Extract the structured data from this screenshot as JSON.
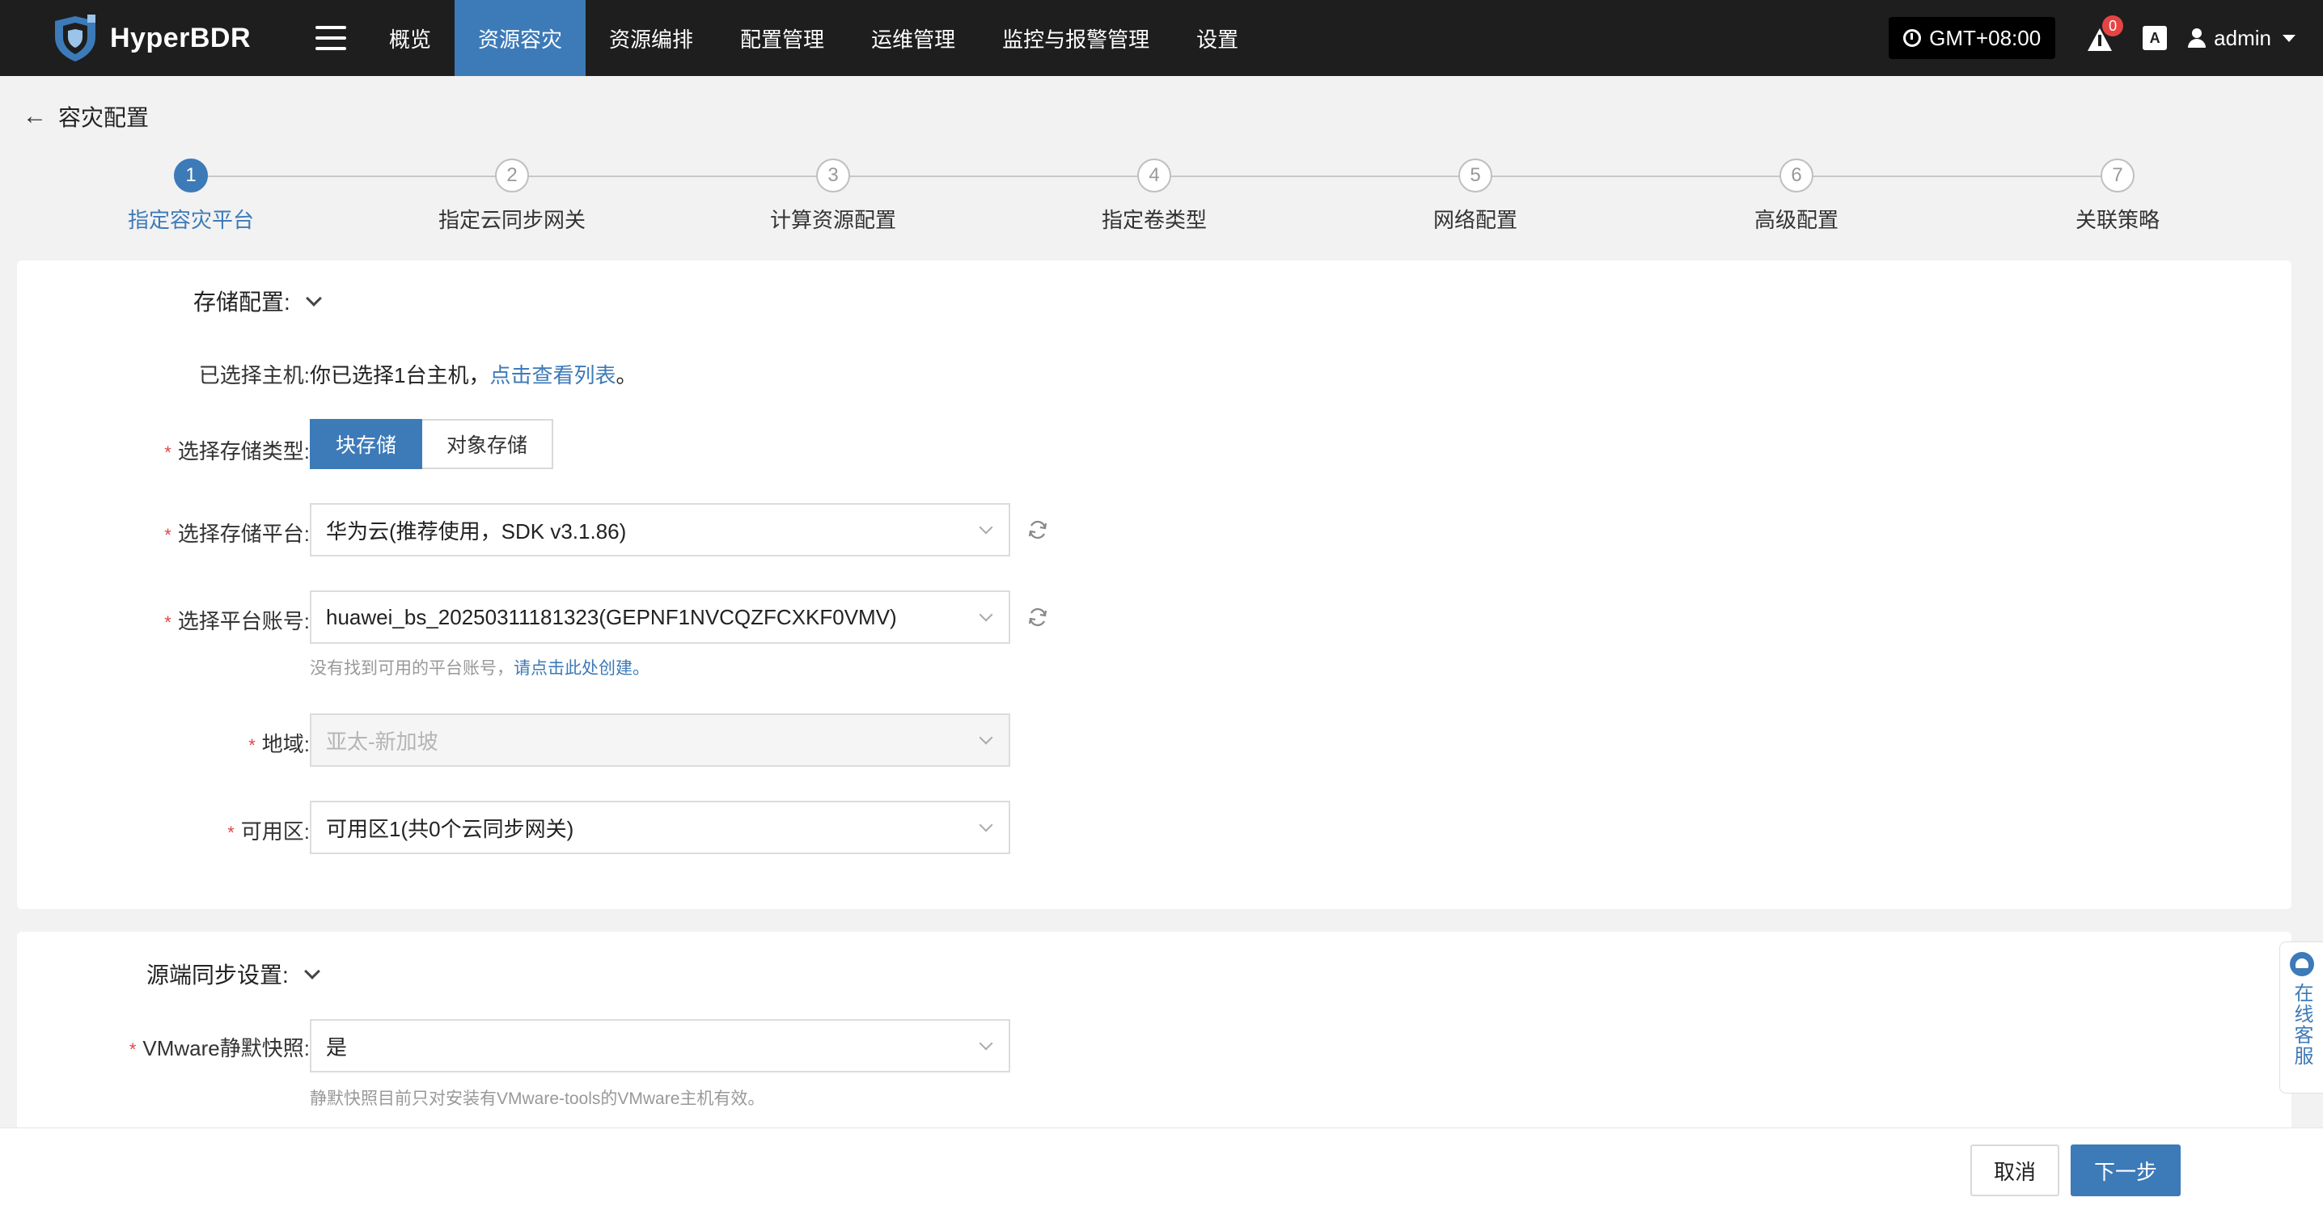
{
  "app": {
    "name": "HyperBDR"
  },
  "nav": {
    "items": [
      {
        "label": "概览",
        "active": false
      },
      {
        "label": "资源容灾",
        "active": true
      },
      {
        "label": "资源编排",
        "active": false
      },
      {
        "label": "配置管理",
        "active": false
      },
      {
        "label": "运维管理",
        "active": false
      },
      {
        "label": "监控与报警管理",
        "active": false
      },
      {
        "label": "设置",
        "active": false
      }
    ]
  },
  "header_right": {
    "timezone": "GMT+08:00",
    "alert_count": "0",
    "lang_label": "A",
    "username": "admin"
  },
  "page": {
    "title": "容灾配置"
  },
  "steps": [
    {
      "num": "1",
      "label": "指定容灾平台"
    },
    {
      "num": "2",
      "label": "指定云同步网关"
    },
    {
      "num": "3",
      "label": "计算资源配置"
    },
    {
      "num": "4",
      "label": "指定卷类型"
    },
    {
      "num": "5",
      "label": "网络配置"
    },
    {
      "num": "6",
      "label": "高级配置"
    },
    {
      "num": "7",
      "label": "关联策略"
    }
  ],
  "storage_section": {
    "title": "存储配置:",
    "selected_hosts_label": "已选择主机:",
    "selected_hosts_text": "你已选择1台主机，",
    "view_list_link": "点击查看列表",
    "period": "。",
    "storage_type_label": "选择存储类型:",
    "storage_types": [
      "块存储",
      "对象存储"
    ],
    "storage_type_selected": "块存储",
    "platform_label": "选择存储平台:",
    "platform_value": "华为云(推荐使用，SDK v3.1.86)",
    "account_label": "选择平台账号:",
    "account_value": "huawei_bs_20250311181323(GEPNF1NVCQZFCXKF0VMV)",
    "account_hint": "没有找到可用的平台账号，",
    "account_hint_link": "请点击此处创建。",
    "region_label": "地域:",
    "region_value": "亚太-新加坡",
    "zone_label": "可用区:",
    "zone_value": "可用区1(共0个云同步网关)"
  },
  "source_section": {
    "title": "源端同步设置:",
    "snapshot_label": "VMware静默快照:",
    "snapshot_value": "是",
    "snapshot_hint": "静默快照目前只对安装有VMware-tools的VMware主机有效。"
  },
  "footer": {
    "cancel_label": "取消",
    "next_label": "下一步"
  },
  "service": {
    "label": "在线客服"
  },
  "colors": {
    "primary": "#3d7ab8",
    "topbar": "#1e1e1e",
    "required": "#e64444"
  }
}
